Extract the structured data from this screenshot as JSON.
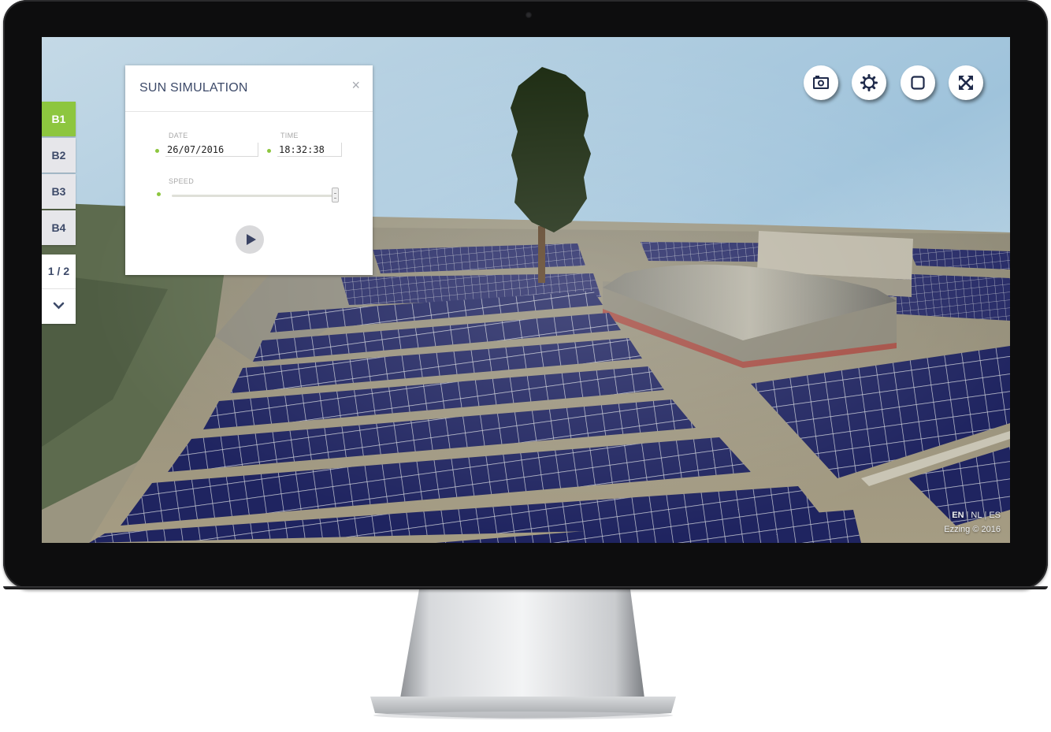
{
  "sun_simulation": {
    "title": "SUN SIMULATION",
    "close_symbol": "×",
    "date_label": "DATE",
    "date_value": "26/07/2016",
    "time_label": "TIME",
    "time_value": "18:32:38",
    "speed_label": "SPEED",
    "speed_level": 1.0,
    "play_icon": "play-icon"
  },
  "building_tabs": [
    {
      "label": "B1",
      "active": true
    },
    {
      "label": "B2",
      "active": false
    },
    {
      "label": "B3",
      "active": false
    },
    {
      "label": "B4",
      "active": false
    }
  ],
  "pager": {
    "label": "1 / 2",
    "next_icon": "chevron-down-icon"
  },
  "toolbar": [
    {
      "icon": "camera-icon"
    },
    {
      "icon": "settings-icon"
    },
    {
      "icon": "square-icon"
    },
    {
      "icon": "fullscreen-icon"
    }
  ],
  "footer": {
    "languages": [
      "EN",
      "NL",
      "ES"
    ],
    "current_language": "EN",
    "copyright": "Ezzing © 2016"
  },
  "colors": {
    "accent_green": "#8dc63f",
    "navy_text": "#3d4a69",
    "panel_blue": "#1f2460"
  }
}
